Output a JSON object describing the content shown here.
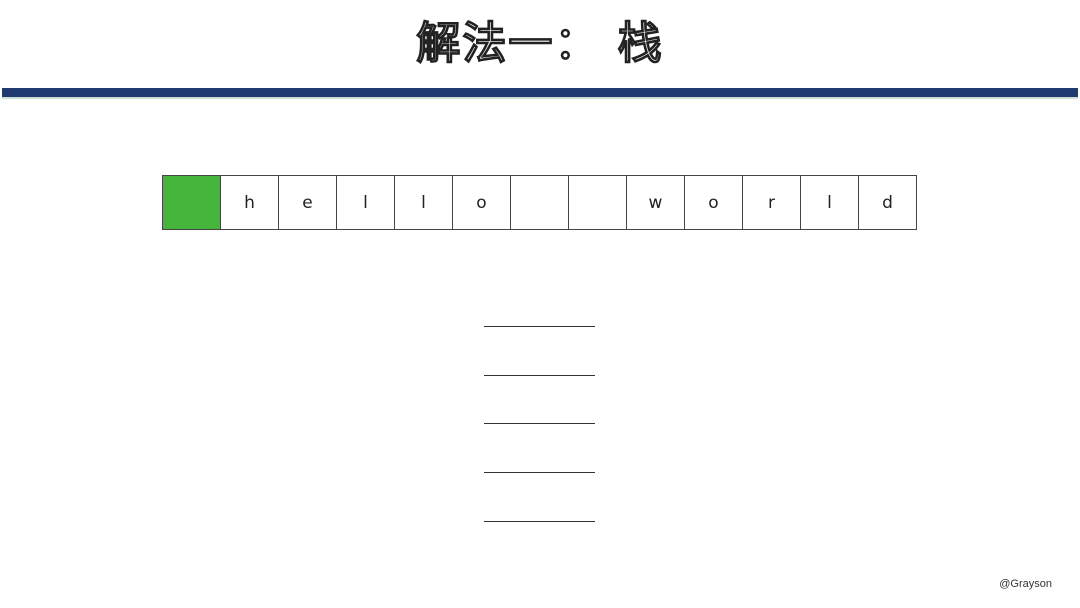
{
  "title": "解法一：  栈",
  "cells": [
    "",
    "h",
    "e",
    "l",
    "l",
    "o",
    "",
    "",
    "w",
    "o",
    "r",
    "l",
    "d"
  ],
  "highlight_color": "#46b53c",
  "rule_color": "#1f3a6e",
  "stack_slots": 5,
  "credit": "@Grayson"
}
